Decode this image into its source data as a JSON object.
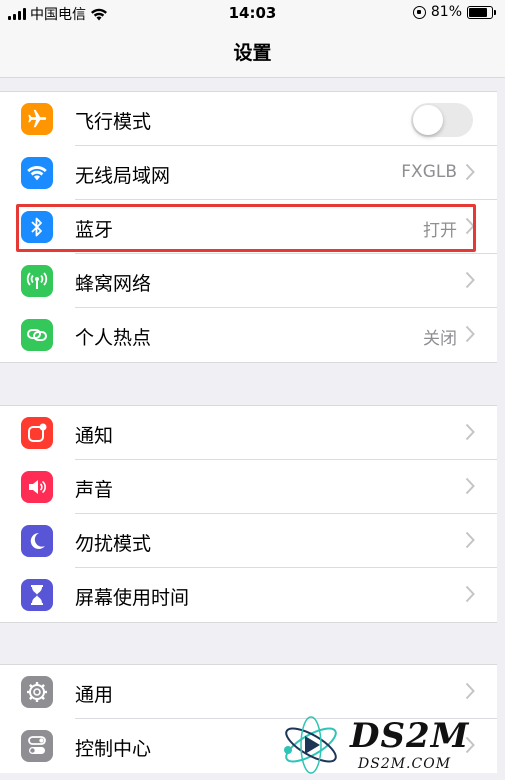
{
  "status_bar": {
    "carrier": "中国电信",
    "time": "14:03",
    "battery": "81%",
    "battery_level": 0.81
  },
  "nav": {
    "title": "设置"
  },
  "groups": [
    {
      "rows": [
        {
          "icon": "airplane-icon",
          "color": "#ff9500",
          "label": "飞行模式",
          "toggle": false
        },
        {
          "icon": "wifi-icon",
          "color": "#1a8cff",
          "label": "无线局域网",
          "value": "FXGLB"
        },
        {
          "icon": "bluetooth-icon",
          "color": "#1a8cff",
          "label": "蓝牙",
          "value": "打开",
          "highlighted": true
        },
        {
          "icon": "cellular-icon",
          "color": "#34c759",
          "label": "蜂窝网络",
          "value": ""
        },
        {
          "icon": "hotspot-icon",
          "color": "#34c759",
          "label": "个人热点",
          "value": "关闭"
        }
      ]
    },
    {
      "rows": [
        {
          "icon": "notifications-icon",
          "color": "#ff3b30",
          "label": "通知"
        },
        {
          "icon": "sound-icon",
          "color": "#ff2d55",
          "label": "声音"
        },
        {
          "icon": "moon-icon",
          "color": "#5856d6",
          "label": "勿扰模式"
        },
        {
          "icon": "hourglass-icon",
          "color": "#5856d6",
          "label": "屏幕使用时间"
        }
      ]
    },
    {
      "rows": [
        {
          "icon": "gear-icon",
          "color": "#8e8e93",
          "label": "通用"
        },
        {
          "icon": "control-center-icon",
          "color": "#8e8e93",
          "label": "控制中心"
        }
      ]
    }
  ],
  "watermark": {
    "brand": "DS2M",
    "site": "DS2M.COM"
  }
}
